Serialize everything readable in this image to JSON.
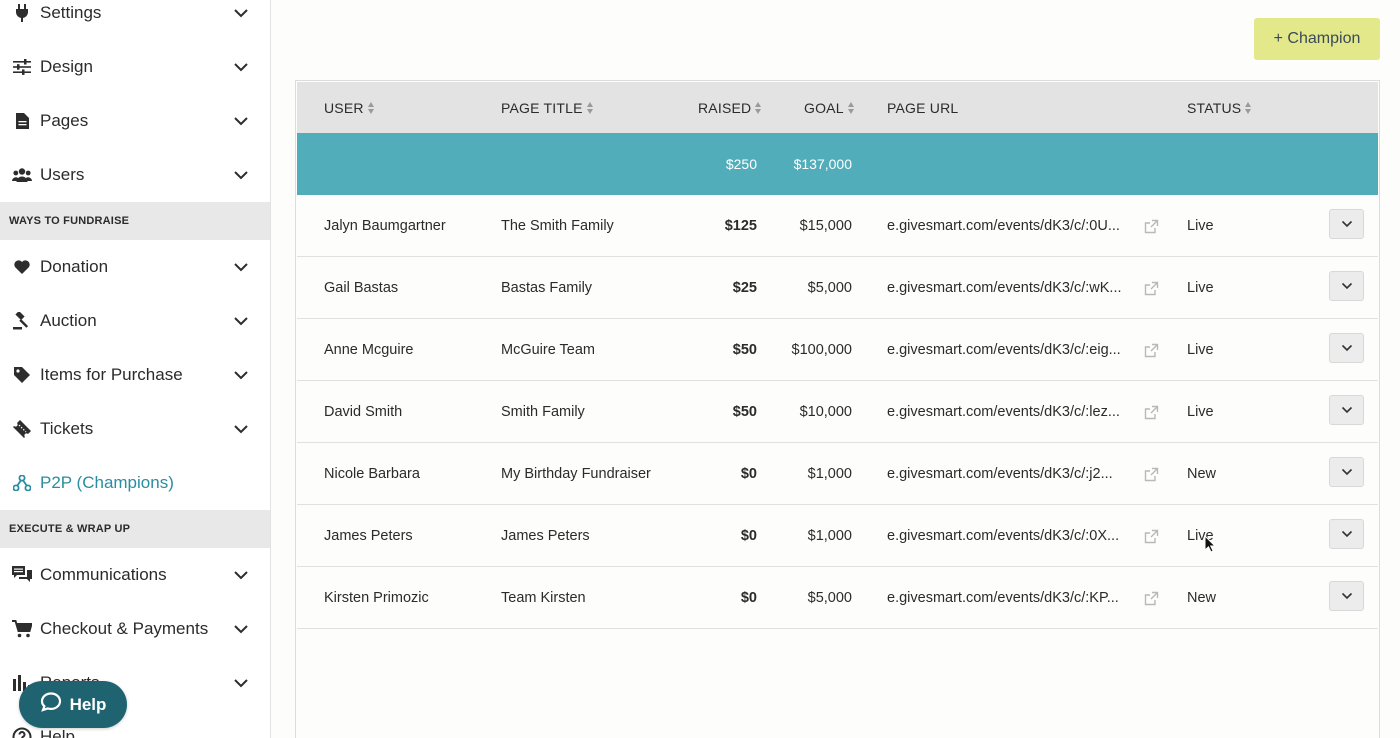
{
  "sidebar": {
    "items_top": [
      {
        "label": "Settings",
        "icon": "plug-icon"
      },
      {
        "label": "Design",
        "icon": "sliders-icon"
      },
      {
        "label": "Pages",
        "icon": "document-icon"
      },
      {
        "label": "Users",
        "icon": "users-icon"
      }
    ],
    "section_fundraise": "WAYS TO FUNDRAISE",
    "items_fundraise": [
      {
        "label": "Donation",
        "icon": "heart-icon"
      },
      {
        "label": "Auction",
        "icon": "gavel-icon"
      },
      {
        "label": "Items for Purchase",
        "icon": "tag-icon"
      },
      {
        "label": "Tickets",
        "icon": "ticket-icon"
      },
      {
        "label": "P2P (Champions)",
        "icon": "network-icon",
        "active": true
      }
    ],
    "section_execute": "EXECUTE & WRAP UP",
    "items_execute": [
      {
        "label": "Communications",
        "icon": "chat-icon"
      },
      {
        "label": "Checkout & Payments",
        "icon": "cart-icon"
      },
      {
        "label": "Reports",
        "icon": "bar-chart-icon"
      },
      {
        "label": "Help",
        "icon": "question-icon"
      }
    ],
    "help_button": "Help",
    "accent_color": "#2a8da0"
  },
  "main": {
    "add_champion_button": "+ Champion",
    "table": {
      "headers": {
        "user": "USER",
        "page_title": "PAGE TITLE",
        "raised": "RAISED",
        "goal": "GOAL",
        "page_url": "PAGE URL",
        "status": "STATUS"
      },
      "totals": {
        "raised": "$250",
        "goal": "$137,000"
      },
      "totals_color": "#52adbb",
      "rows": [
        {
          "user": "Jalyn Baumgartner",
          "title": "The Smith Family",
          "raised": "$125",
          "goal": "$15,000",
          "url": "e.givesmart.com/events/dK3/c/:0U...",
          "status": "Live"
        },
        {
          "user": "Gail Bastas",
          "title": "Bastas Family",
          "raised": "$25",
          "goal": "$5,000",
          "url": "e.givesmart.com/events/dK3/c/:wK...",
          "status": "Live"
        },
        {
          "user": "Anne Mcguire",
          "title": "McGuire Team",
          "raised": "$50",
          "goal": "$100,000",
          "url": "e.givesmart.com/events/dK3/c/:eig...",
          "status": "Live"
        },
        {
          "user": "David Smith",
          "title": "Smith Family",
          "raised": "$50",
          "goal": "$10,000",
          "url": "e.givesmart.com/events/dK3/c/:lez...",
          "status": "Live"
        },
        {
          "user": "Nicole Barbara",
          "title": "My Birthday Fundraiser",
          "raised": "$0",
          "goal": "$1,000",
          "url": "e.givesmart.com/events/dK3/c/:j2...",
          "status": "New"
        },
        {
          "user": "James Peters",
          "title": "James Peters",
          "raised": "$0",
          "goal": "$1,000",
          "url": "e.givesmart.com/events/dK3/c/:0X...",
          "status": "Live"
        },
        {
          "user": "Kirsten Primozic",
          "title": "Team Kirsten",
          "raised": "$0",
          "goal": "$5,000",
          "url": "e.givesmart.com/events/dK3/c/:KP...",
          "status": "New"
        }
      ]
    }
  }
}
